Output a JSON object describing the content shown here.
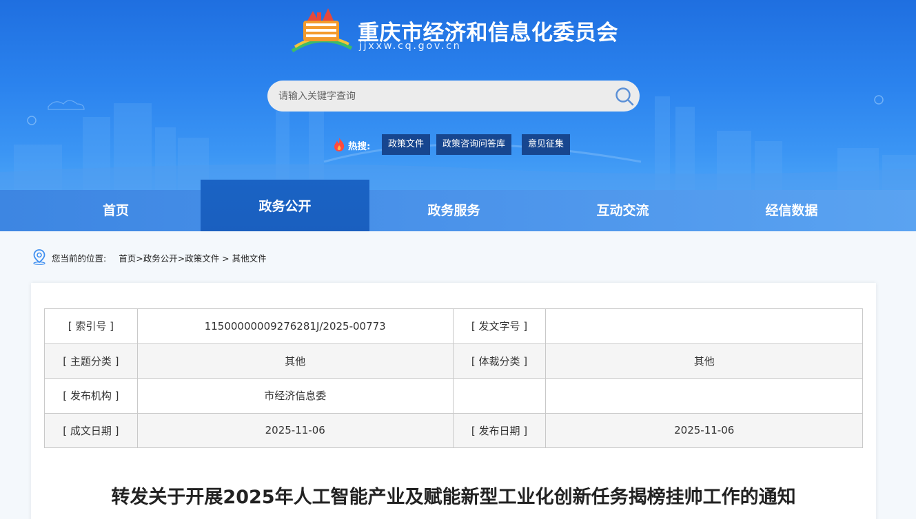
{
  "header": {
    "site_title": "重庆市经济和信息化委员会",
    "site_domain": "jjxxw.cq.gov.cn",
    "search_placeholder": "请输入关键字查询",
    "hot_label": "热搜:",
    "hot_tags": [
      "政策文件",
      "政策咨询问答库",
      "意见征集"
    ]
  },
  "nav": {
    "items": [
      "首页",
      "政务公开",
      "政务服务",
      "互动交流",
      "经信数据"
    ],
    "active": "政务公开"
  },
  "breadcrumb": {
    "prefix": "您当前的位置:",
    "path": [
      "首页",
      ">",
      "政务公开",
      ">",
      "政策文件",
      " > ",
      "其他文件"
    ]
  },
  "meta": {
    "rows": [
      [
        "[ 索引号 ]",
        "11500000009276281J/2025-00773",
        "[ 发文字号 ]",
        ""
      ],
      [
        "[ 主题分类 ]",
        "其他",
        "[ 体裁分类 ]",
        "其他"
      ],
      [
        "[ 发布机构 ]",
        "市经济信息委",
        "",
        ""
      ],
      [
        "[ 成文日期 ]",
        "2025-11-06",
        "[ 发布日期 ]",
        "2025-11-06"
      ]
    ]
  },
  "document": {
    "title": "转发关于开展2025年人工智能产业及赋能新型工业化创新任务揭榜挂帅工作的通知"
  },
  "colors": {
    "banner": "#2b83ee",
    "nav": "#4b93ea",
    "nav_active": "#1a63c4",
    "hot_tag": "#17468f"
  }
}
